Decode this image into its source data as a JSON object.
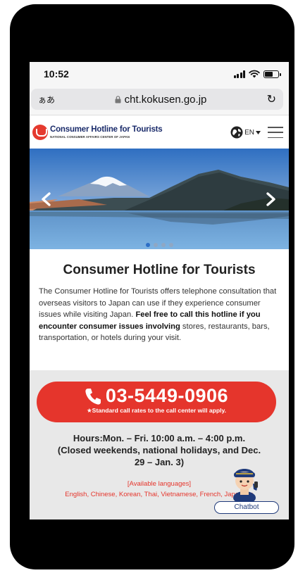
{
  "status_bar": {
    "time": "10:52"
  },
  "browser": {
    "aa_label": "ぁあ",
    "url": "cht.kokusen.go.jp",
    "reload_glyph": "↻"
  },
  "site": {
    "logo_title": "Consumer Hotline for Tourists",
    "logo_subtitle": "NATIONAL CONSUMER AFFAIRS CENTER OF JAPAN",
    "language": "EN"
  },
  "carousel": {
    "slide_count": 4,
    "active_index": 0
  },
  "main": {
    "title": "Consumer Hotline for Tourists",
    "description_plain": "The Consumer Hotline for Tourists offers telephone consultation that overseas visitors to Japan can use if they experience consumer issues while visiting Japan.",
    "description_bold": "Feel free to call this hotline if you encounter consumer issues involving",
    "description_tail": " stores, restaurants, bars, transportation, or hotels during your visit."
  },
  "hotline": {
    "phone_number": "03-5449-0906",
    "rates_note": "★Standard call rates to the call center will apply.",
    "hours_line1": "Hours:Mon. – Fri. 10:00 a.m. – 4:00 p.m.",
    "hours_line2": "(Closed weekends, national holidays, and Dec.",
    "hours_line3": "29 – Jan. 3)",
    "available_label": "[Available languages]",
    "languages": "English, Chinese, Korean, Thai, Vietnamese, French, Japanese"
  },
  "chatbot": {
    "label": "Chatbot"
  },
  "colors": {
    "accent_red": "#e5352c",
    "navy": "#1b2c6b",
    "gray_bg": "#e8e8e8"
  }
}
